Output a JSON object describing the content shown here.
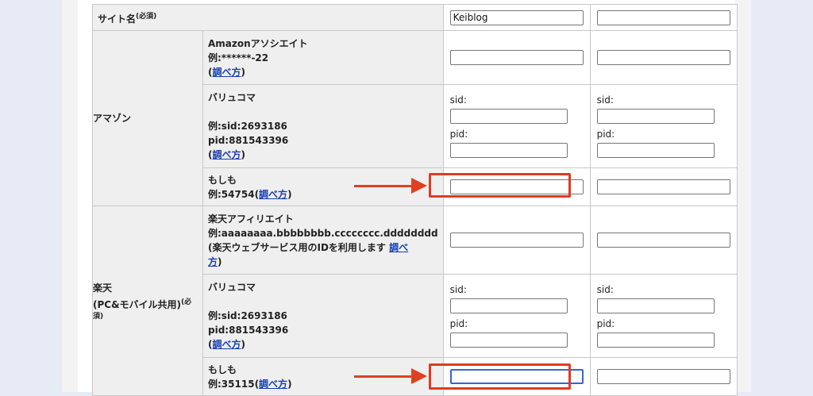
{
  "site_name": {
    "label": "サイト名",
    "required": "(必須)",
    "value": "Keiblog"
  },
  "amazon": {
    "category": "アマゾン",
    "associate": {
      "name": "Amazonアソシエイト",
      "example": "例:******-22",
      "paren_open": "(",
      "link": "調べ方",
      "paren_close": ")"
    },
    "valuecommerce": {
      "name": "バリュコマ",
      "example_sid": "例:sid:2693186",
      "example_pid": "pid:881543396",
      "paren_open": "(",
      "link": "調べ方",
      "paren_close": ")",
      "sid_label": "sid:",
      "pid_label": "pid:"
    },
    "moshimo": {
      "name": "もしも",
      "example": "例:54754",
      "paren_open": "(",
      "link": "調べ方",
      "paren_close": ")"
    }
  },
  "rakuten": {
    "category_line1": "楽天",
    "category_line2": "(PC&モバイル共用)",
    "required": "(必",
    "required2": "須)",
    "affiliate": {
      "name": "楽天アフィリエイト",
      "example": "例:aaaaaaaa.bbbbbbbb.cccccccc.dddddddd",
      "note": "(楽天ウェブサービス用のIDを利用します ",
      "link_part1": "調べ",
      "link_part2": "方",
      "paren_close": ")"
    },
    "valuecommerce": {
      "name": "バリュコマ",
      "example_sid": "例:sid:2693186",
      "example_pid": "pid:881543396",
      "paren_open": "(",
      "link": "調べ方",
      "paren_close": ")",
      "sid_label": "sid:",
      "pid_label": "pid:"
    },
    "moshimo": {
      "name": "もしも",
      "example": "例:35115",
      "paren_open": "(",
      "link": "調べ方",
      "paren_close": ")"
    }
  },
  "colors": {
    "highlight": "#de3b24",
    "link": "#1a3fb0",
    "label_bg": "#efefef"
  }
}
